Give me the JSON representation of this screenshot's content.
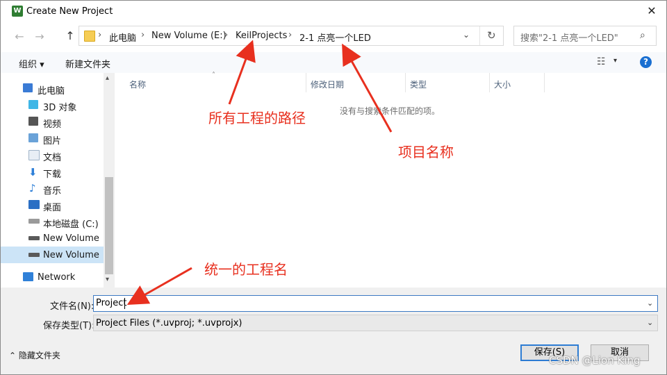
{
  "window": {
    "title": "Create New Project",
    "app_icon_letter": "W",
    "close_glyph": "✕"
  },
  "nav": {
    "back": "←",
    "forward": "→",
    "up": "↑",
    "breadcrumb": [
      "此电脑",
      "New Volume (E:)",
      "KeilProjects",
      "2-1 点亮一个LED"
    ],
    "separator": "›",
    "dropdown": "⌄",
    "refresh": "↻",
    "search_placeholder": "搜索\"2-1 点亮一个LED\"",
    "search_icon": "⌕"
  },
  "toolbar": {
    "organize": "组织 ▾",
    "new_folder": "新建文件夹",
    "view_icon": "☷",
    "view_dropdown": "▾",
    "help": "?"
  },
  "sidebar": {
    "items": [
      {
        "label": "此电脑",
        "icon": "computer-icon",
        "color": "#3a7bd5"
      },
      {
        "label": "3D 对象",
        "icon": "3d-objects-icon",
        "color": "#3fb6e6"
      },
      {
        "label": "视频",
        "icon": "video-icon",
        "color": "#555555"
      },
      {
        "label": "图片",
        "icon": "picture-icon",
        "color": "#6aa2d8"
      },
      {
        "label": "文档",
        "icon": "document-icon",
        "color": "#9fb3c8"
      },
      {
        "label": "下载",
        "icon": "download-icon",
        "color": "#2f80d8"
      },
      {
        "label": "音乐",
        "icon": "music-icon",
        "color": "#2f80d8"
      },
      {
        "label": "桌面",
        "icon": "desktop-icon",
        "color": "#2b6fc4"
      },
      {
        "label": "本地磁盘 (C:)",
        "icon": "drive-c-icon",
        "color": "#7a7a7a"
      },
      {
        "label": "New Volume (D",
        "icon": "drive-d-icon",
        "color": "#5a5a5a"
      },
      {
        "label": "New Volume (E",
        "icon": "drive-e-icon",
        "color": "#5a5a5a"
      },
      {
        "label": "Network",
        "icon": "network-icon",
        "color": "#2f80d8"
      }
    ],
    "scroll_up": "▴",
    "scroll_down": "▾"
  },
  "content": {
    "columns": [
      "名称",
      "修改日期",
      "类型",
      "大小"
    ],
    "sort_caret": "˄",
    "empty_message": "没有与搜索条件匹配的项。"
  },
  "form": {
    "filename_label": "文件名(N):",
    "filename_value": "Project",
    "filetype_label": "保存类型(T):",
    "filetype_value": "Project Files (*.uvproj; *.uvprojx)",
    "dropdown": "⌄",
    "hide_folders": "⌃  隐藏文件夹",
    "save_button": "保存(S)",
    "cancel_button": "取消"
  },
  "annotations": {
    "path_note": "所有工程的路径",
    "project_note": "项目名称",
    "name_note": "统一的工程名",
    "color": "#e8301f"
  },
  "watermark": "CSDN @Lion King"
}
